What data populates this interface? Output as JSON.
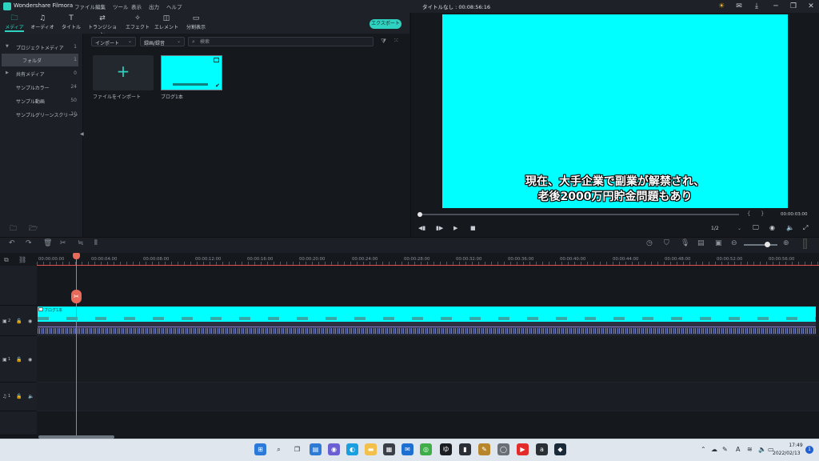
{
  "window": {
    "app_name": "Wondershare Filmora",
    "menus": [
      "ファイル",
      "編集",
      "ツール",
      "表示",
      "出力",
      "ヘルプ"
    ],
    "doc_title": "タイトルなし : 00:08:56:16"
  },
  "tabs": [
    {
      "label": "メディア",
      "icon": "folder-icon"
    },
    {
      "label": "オーディオ",
      "icon": "music-note-icon"
    },
    {
      "label": "タイトル",
      "icon": "text-icon"
    },
    {
      "label": "トランジション",
      "icon": "transition-icon"
    },
    {
      "label": "エフェクト",
      "icon": "effect-icon"
    },
    {
      "label": "エレメント",
      "icon": "element-icon"
    },
    {
      "label": "分割表示",
      "icon": "split-screen-icon"
    }
  ],
  "export_label": "エクスポート",
  "sidebar": {
    "items": [
      {
        "label": "プロジェクトメディア",
        "count": "1"
      },
      {
        "label": "フォルダ",
        "count": "1"
      },
      {
        "label": "共有メディア",
        "count": "0"
      },
      {
        "label": "サンプルカラー",
        "count": "24"
      },
      {
        "label": "サンプル動画",
        "count": "50"
      },
      {
        "label": "サンプルグリーンスクリーン",
        "count": "10"
      }
    ]
  },
  "media": {
    "import_dropdown": "インポート",
    "record_dropdown": "録画/録音",
    "search_placeholder": "検索",
    "import_tile_label": "ファイルをインポート",
    "clip_label": "ブログ1本"
  },
  "preview": {
    "subtitle_line1": "現在、大手企業で副業が解禁され、",
    "subtitle_line2": "老後2000万円貯金問題もあり",
    "timecode": "00:00:03:00",
    "ratio": "1/2"
  },
  "ruler": {
    "labels": [
      "00:00:00:00",
      "00:00:04:00",
      "00:00:08:00",
      "00:00:12:00",
      "00:00:16:00",
      "00:00:20:00",
      "00:00:24:00",
      "00:00:28:00",
      "00:00:32:00",
      "00:00:36:00",
      "00:00:40:00",
      "00:00:44:00",
      "00:00:48:00",
      "00:00:52:00",
      "00:00:56:00"
    ]
  },
  "timeline": {
    "clip_title": "ブログ1本",
    "tracks": [
      "2",
      "1",
      "1"
    ]
  },
  "taskbar": {
    "time": "17:49",
    "date": "2022/02/13",
    "notification_count": "1",
    "ime": "A"
  },
  "colors": {
    "accent": "#2fd2c0",
    "clip": "#00ffff",
    "playhead": "#e86a5a"
  }
}
